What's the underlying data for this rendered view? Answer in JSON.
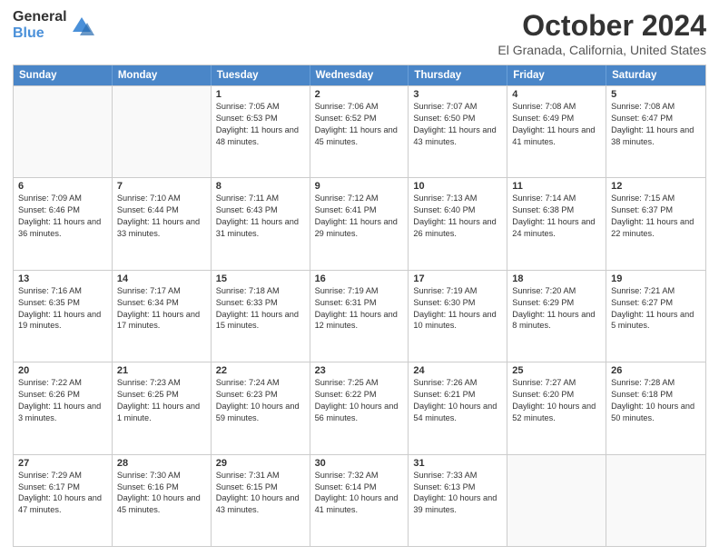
{
  "logo": {
    "general": "General",
    "blue": "Blue"
  },
  "title": "October 2024",
  "subtitle": "El Granada, California, United States",
  "days": [
    "Sunday",
    "Monday",
    "Tuesday",
    "Wednesday",
    "Thursday",
    "Friday",
    "Saturday"
  ],
  "weeks": [
    [
      {
        "day": "",
        "info": "",
        "empty": true
      },
      {
        "day": "",
        "info": "",
        "empty": true
      },
      {
        "day": "1",
        "info": "Sunrise: 7:05 AM\nSunset: 6:53 PM\nDaylight: 11 hours and 48 minutes."
      },
      {
        "day": "2",
        "info": "Sunrise: 7:06 AM\nSunset: 6:52 PM\nDaylight: 11 hours and 45 minutes."
      },
      {
        "day": "3",
        "info": "Sunrise: 7:07 AM\nSunset: 6:50 PM\nDaylight: 11 hours and 43 minutes."
      },
      {
        "day": "4",
        "info": "Sunrise: 7:08 AM\nSunset: 6:49 PM\nDaylight: 11 hours and 41 minutes."
      },
      {
        "day": "5",
        "info": "Sunrise: 7:08 AM\nSunset: 6:47 PM\nDaylight: 11 hours and 38 minutes."
      }
    ],
    [
      {
        "day": "6",
        "info": "Sunrise: 7:09 AM\nSunset: 6:46 PM\nDaylight: 11 hours and 36 minutes."
      },
      {
        "day": "7",
        "info": "Sunrise: 7:10 AM\nSunset: 6:44 PM\nDaylight: 11 hours and 33 minutes."
      },
      {
        "day": "8",
        "info": "Sunrise: 7:11 AM\nSunset: 6:43 PM\nDaylight: 11 hours and 31 minutes."
      },
      {
        "day": "9",
        "info": "Sunrise: 7:12 AM\nSunset: 6:41 PM\nDaylight: 11 hours and 29 minutes."
      },
      {
        "day": "10",
        "info": "Sunrise: 7:13 AM\nSunset: 6:40 PM\nDaylight: 11 hours and 26 minutes."
      },
      {
        "day": "11",
        "info": "Sunrise: 7:14 AM\nSunset: 6:38 PM\nDaylight: 11 hours and 24 minutes."
      },
      {
        "day": "12",
        "info": "Sunrise: 7:15 AM\nSunset: 6:37 PM\nDaylight: 11 hours and 22 minutes."
      }
    ],
    [
      {
        "day": "13",
        "info": "Sunrise: 7:16 AM\nSunset: 6:35 PM\nDaylight: 11 hours and 19 minutes."
      },
      {
        "day": "14",
        "info": "Sunrise: 7:17 AM\nSunset: 6:34 PM\nDaylight: 11 hours and 17 minutes."
      },
      {
        "day": "15",
        "info": "Sunrise: 7:18 AM\nSunset: 6:33 PM\nDaylight: 11 hours and 15 minutes."
      },
      {
        "day": "16",
        "info": "Sunrise: 7:19 AM\nSunset: 6:31 PM\nDaylight: 11 hours and 12 minutes."
      },
      {
        "day": "17",
        "info": "Sunrise: 7:19 AM\nSunset: 6:30 PM\nDaylight: 11 hours and 10 minutes."
      },
      {
        "day": "18",
        "info": "Sunrise: 7:20 AM\nSunset: 6:29 PM\nDaylight: 11 hours and 8 minutes."
      },
      {
        "day": "19",
        "info": "Sunrise: 7:21 AM\nSunset: 6:27 PM\nDaylight: 11 hours and 5 minutes."
      }
    ],
    [
      {
        "day": "20",
        "info": "Sunrise: 7:22 AM\nSunset: 6:26 PM\nDaylight: 11 hours and 3 minutes."
      },
      {
        "day": "21",
        "info": "Sunrise: 7:23 AM\nSunset: 6:25 PM\nDaylight: 11 hours and 1 minute."
      },
      {
        "day": "22",
        "info": "Sunrise: 7:24 AM\nSunset: 6:23 PM\nDaylight: 10 hours and 59 minutes."
      },
      {
        "day": "23",
        "info": "Sunrise: 7:25 AM\nSunset: 6:22 PM\nDaylight: 10 hours and 56 minutes."
      },
      {
        "day": "24",
        "info": "Sunrise: 7:26 AM\nSunset: 6:21 PM\nDaylight: 10 hours and 54 minutes."
      },
      {
        "day": "25",
        "info": "Sunrise: 7:27 AM\nSunset: 6:20 PM\nDaylight: 10 hours and 52 minutes."
      },
      {
        "day": "26",
        "info": "Sunrise: 7:28 AM\nSunset: 6:18 PM\nDaylight: 10 hours and 50 minutes."
      }
    ],
    [
      {
        "day": "27",
        "info": "Sunrise: 7:29 AM\nSunset: 6:17 PM\nDaylight: 10 hours and 47 minutes."
      },
      {
        "day": "28",
        "info": "Sunrise: 7:30 AM\nSunset: 6:16 PM\nDaylight: 10 hours and 45 minutes."
      },
      {
        "day": "29",
        "info": "Sunrise: 7:31 AM\nSunset: 6:15 PM\nDaylight: 10 hours and 43 minutes."
      },
      {
        "day": "30",
        "info": "Sunrise: 7:32 AM\nSunset: 6:14 PM\nDaylight: 10 hours and 41 minutes."
      },
      {
        "day": "31",
        "info": "Sunrise: 7:33 AM\nSunset: 6:13 PM\nDaylight: 10 hours and 39 minutes."
      },
      {
        "day": "",
        "info": "",
        "empty": true
      },
      {
        "day": "",
        "info": "",
        "empty": true
      }
    ]
  ]
}
